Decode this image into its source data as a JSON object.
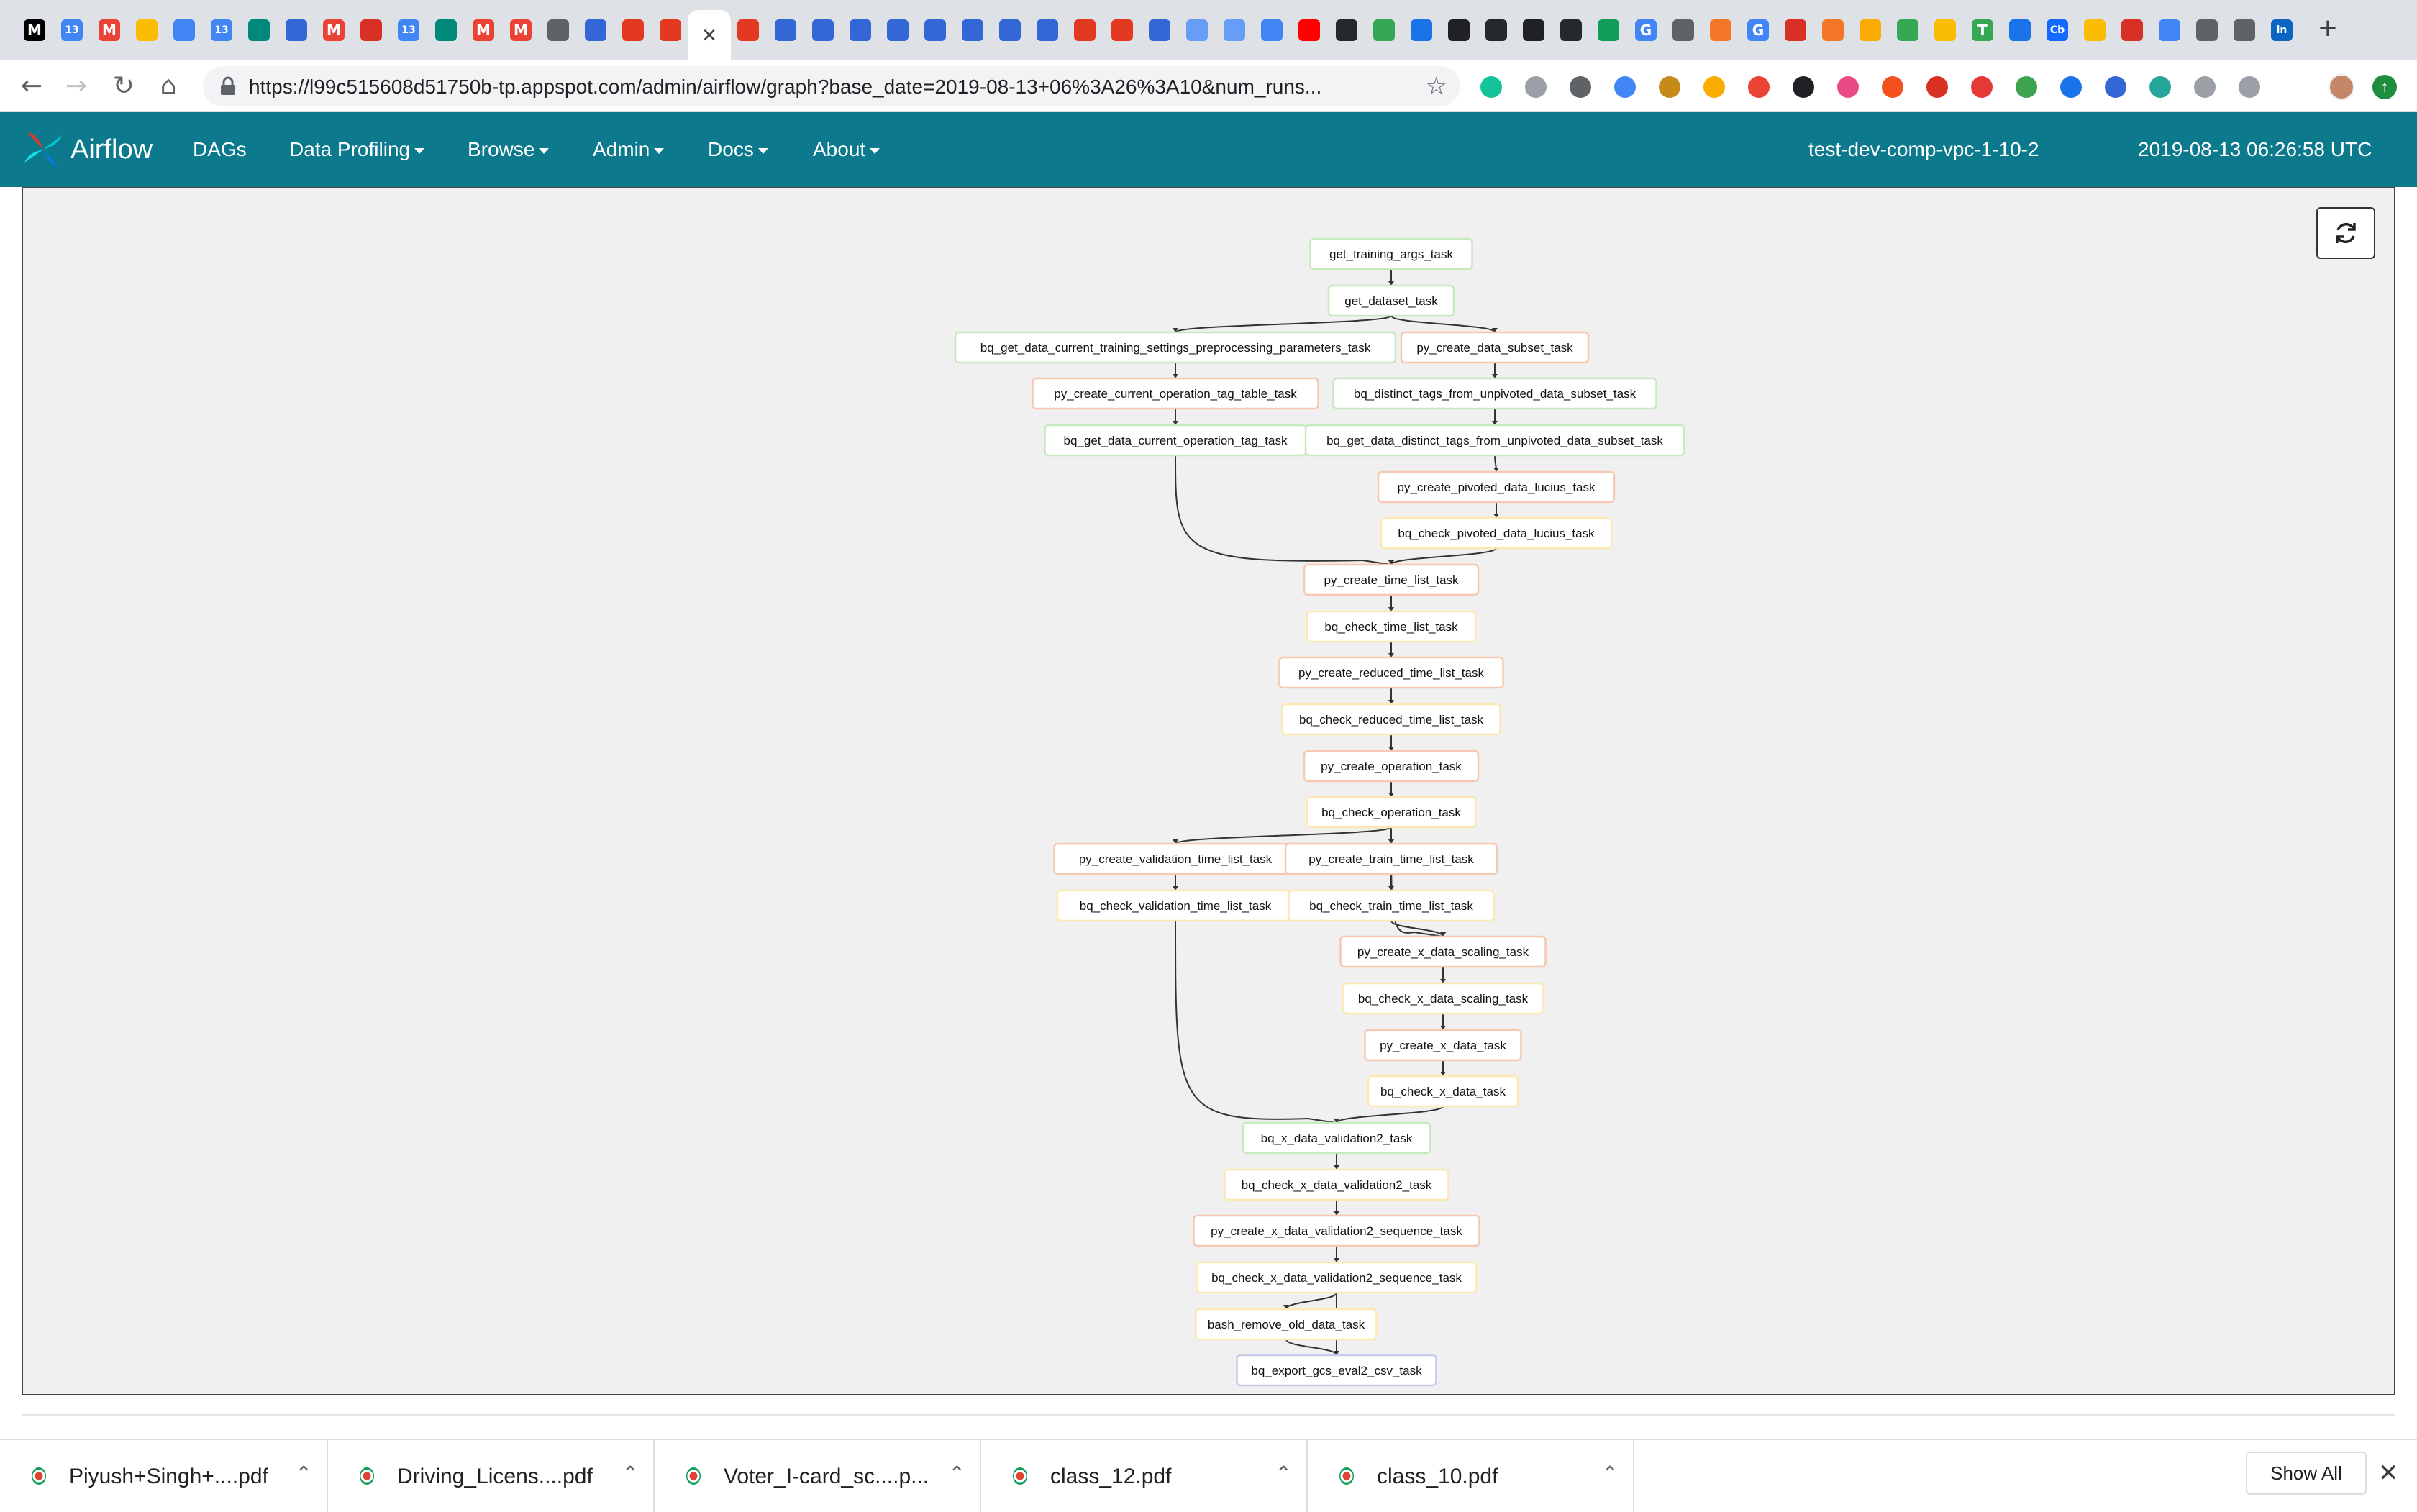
{
  "browser": {
    "tabs": [
      {
        "icon": "medium-icon",
        "glyph": "M",
        "color": "#000000"
      },
      {
        "icon": "calendar-icon",
        "glyph": "13",
        "color": "#4285f4"
      },
      {
        "icon": "gmail-icon",
        "glyph": "M",
        "color": "#ea4335"
      },
      {
        "icon": "slides-icon",
        "glyph": "",
        "color": "#fbbc04"
      },
      {
        "icon": "shield-icon",
        "glyph": "",
        "color": "#4285f4"
      },
      {
        "icon": "calendar-icon",
        "glyph": "13",
        "color": "#4285f4"
      },
      {
        "icon": "meet-icon",
        "glyph": "",
        "color": "#00897b"
      },
      {
        "icon": "list-icon",
        "glyph": "",
        "color": "#3367d6"
      },
      {
        "icon": "gmail-icon",
        "glyph": "M",
        "color": "#ea4335"
      },
      {
        "icon": "record-icon",
        "glyph": "",
        "color": "#d93025"
      },
      {
        "icon": "calendar-icon",
        "glyph": "13",
        "color": "#4285f4"
      },
      {
        "icon": "meet-icon",
        "glyph": "",
        "color": "#00897b"
      },
      {
        "icon": "gmail-icon",
        "glyph": "M",
        "color": "#ea4335"
      },
      {
        "icon": "gmail-icon",
        "glyph": "M",
        "color": "#ea4335"
      },
      {
        "icon": "gear-icon",
        "glyph": "",
        "color": "#5f6368"
      },
      {
        "icon": "storage-icon",
        "glyph": "",
        "color": "#3367d6"
      },
      {
        "icon": "airflow-icon",
        "glyph": "",
        "color": "#e43921"
      },
      {
        "icon": "airflow-icon",
        "glyph": "",
        "color": "#e43921"
      },
      {
        "icon": "airflow-icon",
        "glyph": "",
        "color": "#e43921"
      },
      {
        "icon": "cloud-icon",
        "glyph": "",
        "color": "#3367d6"
      },
      {
        "icon": "cloud-icon",
        "glyph": "",
        "color": "#3367d6"
      },
      {
        "icon": "list-icon",
        "glyph": "",
        "color": "#3367d6"
      },
      {
        "icon": "list-icon",
        "glyph": "",
        "color": "#3367d6"
      },
      {
        "icon": "cloud-icon",
        "glyph": "",
        "color": "#3367d6"
      },
      {
        "icon": "list-icon",
        "glyph": "",
        "color": "#3367d6"
      },
      {
        "icon": "list-icon",
        "glyph": "",
        "color": "#3367d6"
      },
      {
        "icon": "storage-icon",
        "glyph": "",
        "color": "#3367d6"
      },
      {
        "icon": "airflow-icon",
        "glyph": "",
        "color": "#e43921"
      },
      {
        "icon": "airflow-icon",
        "glyph": "",
        "color": "#e43921"
      },
      {
        "icon": "search-icon",
        "glyph": "",
        "color": "#3367d6"
      },
      {
        "icon": "hexagon-icon",
        "glyph": "",
        "color": "#669df6"
      },
      {
        "icon": "hexagon-icon",
        "glyph": "",
        "color": "#669df6"
      },
      {
        "icon": "onedrive-icon",
        "glyph": "",
        "color": "#4285f4"
      },
      {
        "icon": "youtube-icon",
        "glyph": "",
        "color": "#ff0000"
      },
      {
        "icon": "github-icon",
        "glyph": "",
        "color": "#24292e"
      },
      {
        "icon": "smile-icon",
        "glyph": "",
        "color": "#34a853"
      },
      {
        "icon": "vscode-icon",
        "glyph": "",
        "color": "#1a73e8"
      },
      {
        "icon": "music-icon",
        "glyph": "",
        "color": "#202124"
      },
      {
        "icon": "github-icon",
        "glyph": "",
        "color": "#24292e"
      },
      {
        "icon": "music-icon",
        "glyph": "",
        "color": "#202124"
      },
      {
        "icon": "github-icon",
        "glyph": "",
        "color": "#24292e"
      },
      {
        "icon": "excel-icon",
        "glyph": "",
        "color": "#0f9d58"
      },
      {
        "icon": "google-icon",
        "glyph": "G",
        "color": "#4285f4"
      },
      {
        "icon": "chrome-icon",
        "glyph": "",
        "color": "#5f6368"
      },
      {
        "icon": "jupyter-icon",
        "glyph": "",
        "color": "#f37726"
      },
      {
        "icon": "google-icon",
        "glyph": "G",
        "color": "#4285f4"
      },
      {
        "icon": "code-icon",
        "glyph": "",
        "color": "#d93025"
      },
      {
        "icon": "jupyter-icon",
        "glyph": "",
        "color": "#f37726"
      },
      {
        "icon": "notebook-icon",
        "glyph": "",
        "color": "#f9ab00"
      },
      {
        "icon": "w3-icon",
        "glyph": "",
        "color": "#34a853"
      },
      {
        "icon": "gear-icon",
        "glyph": "",
        "color": "#fbbc04"
      },
      {
        "icon": "text-icon",
        "glyph": "T",
        "color": "#34a853"
      },
      {
        "icon": "vscode-icon",
        "glyph": "",
        "color": "#1a73e8"
      },
      {
        "icon": "crunchbase-icon",
        "glyph": "Cb",
        "color": "#146aff"
      },
      {
        "icon": "drive-icon",
        "glyph": "",
        "color": "#fbbc04"
      },
      {
        "icon": "bug-icon",
        "glyph": "",
        "color": "#d93025"
      },
      {
        "icon": "flow-icon",
        "glyph": "",
        "color": "#4285f4"
      },
      {
        "icon": "chrome-icon",
        "glyph": "",
        "color": "#5f6368"
      },
      {
        "icon": "chrome-icon",
        "glyph": "",
        "color": "#5f6368"
      },
      {
        "icon": "linkedin-icon",
        "glyph": "in",
        "color": "#0a66c2"
      }
    ],
    "active_tab_icon": "close-icon",
    "url": "https://l99c515608d51750b-tp.appspot.com/admin/airflow/graph?base_date=2019-08-13+06%3A26%3A10&num_runs...",
    "extensions": [
      {
        "icon": "grammarly-icon",
        "color": "#15c39a"
      },
      {
        "icon": "extension-icon",
        "color": "#9aa0a6"
      },
      {
        "icon": "laptop-icon",
        "color": "#5f6368"
      },
      {
        "icon": "window-icon",
        "color": "#4285f4"
      },
      {
        "icon": "film-icon",
        "color": "#c58a1a"
      },
      {
        "icon": "note-icon",
        "color": "#f9ab00"
      },
      {
        "icon": "pie-icon",
        "color": "#ea4335"
      },
      {
        "icon": "braces-icon",
        "color": "#202124"
      },
      {
        "icon": "cat-icon",
        "color": "#e94b87"
      },
      {
        "icon": "fire-icon",
        "color": "#f4511e"
      },
      {
        "icon": "forward-icon",
        "color": "#d93025"
      },
      {
        "icon": "adblock-icon",
        "color": "#e53935"
      },
      {
        "icon": "cors-icon",
        "color": "#3ea34f"
      },
      {
        "icon": "shield-icon",
        "color": "#1a73e8"
      },
      {
        "icon": "lastpass-icon",
        "color": "#3367d6"
      },
      {
        "icon": "circle-icon",
        "color": "#26a69a"
      },
      {
        "icon": "puzzle-icon",
        "color": "#9aa0a6"
      },
      {
        "icon": "doc-icon",
        "color": "#9aa0a6"
      }
    ]
  },
  "navbar": {
    "brand": "Airflow",
    "items": [
      {
        "label": "DAGs",
        "dropdown": false
      },
      {
        "label": "Data Profiling",
        "dropdown": true
      },
      {
        "label": "Browse",
        "dropdown": true
      },
      {
        "label": "Admin",
        "dropdown": true
      },
      {
        "label": "Docs",
        "dropdown": true
      },
      {
        "label": "About",
        "dropdown": true
      }
    ],
    "hostname": "test-dev-comp-vpc-1-10-2",
    "time": "2019-08-13 06:26:58 UTC",
    "color": "#0c7a8c"
  },
  "graph": {
    "status_colors": {
      "green": "#c7e9c0",
      "peach": "#f7c8b0",
      "yellow": "#fce8b0",
      "blue": "#c5cbe9"
    },
    "tasks": [
      {
        "id": "t1",
        "label": "get_training_args_task",
        "status": "green"
      },
      {
        "id": "t2",
        "label": "get_dataset_task",
        "status": "green"
      },
      {
        "id": "t3",
        "label": "bq_get_data_current_training_settings_preprocessing_parameters_task",
        "status": "green"
      },
      {
        "id": "t4",
        "label": "py_create_data_subset_task",
        "status": "peach"
      },
      {
        "id": "t5",
        "label": "py_create_current_operation_tag_table_task",
        "status": "peach"
      },
      {
        "id": "t6",
        "label": "bq_distinct_tags_from_unpivoted_data_subset_task",
        "status": "green"
      },
      {
        "id": "t7",
        "label": "bq_get_data_current_operation_tag_task",
        "status": "green"
      },
      {
        "id": "t8",
        "label": "bq_get_data_distinct_tags_from_unpivoted_data_subset_task",
        "status": "green"
      },
      {
        "id": "t9",
        "label": "py_create_pivoted_data_lucius_task",
        "status": "peach"
      },
      {
        "id": "t10",
        "label": "bq_check_pivoted_data_lucius_task",
        "status": "yellow"
      },
      {
        "id": "t11",
        "label": "py_create_time_list_task",
        "status": "peach"
      },
      {
        "id": "t12",
        "label": "bq_check_time_list_task",
        "status": "yellow"
      },
      {
        "id": "t13",
        "label": "py_create_reduced_time_list_task",
        "status": "peach"
      },
      {
        "id": "t14",
        "label": "bq_check_reduced_time_list_task",
        "status": "yellow"
      },
      {
        "id": "t15",
        "label": "py_create_operation_task",
        "status": "peach"
      },
      {
        "id": "t16",
        "label": "bq_check_operation_task",
        "status": "yellow"
      },
      {
        "id": "t17",
        "label": "py_create_validation_time_list_task",
        "status": "peach"
      },
      {
        "id": "t18",
        "label": "py_create_train_time_list_task",
        "status": "peach"
      },
      {
        "id": "t19",
        "label": "bq_check_validation_time_list_task",
        "status": "yellow"
      },
      {
        "id": "t20",
        "label": "bq_check_train_time_list_task",
        "status": "yellow"
      },
      {
        "id": "t21",
        "label": "py_create_x_data_scaling_task",
        "status": "peach"
      },
      {
        "id": "t22",
        "label": "bq_check_x_data_scaling_task",
        "status": "yellow"
      },
      {
        "id": "t23",
        "label": "py_create_x_data_task",
        "status": "peach"
      },
      {
        "id": "t24",
        "label": "bq_check_x_data_task",
        "status": "yellow"
      },
      {
        "id": "t25",
        "label": "bq_x_data_validation2_task",
        "status": "green"
      },
      {
        "id": "t26",
        "label": "bq_check_x_data_validation2_task",
        "status": "yellow"
      },
      {
        "id": "t27",
        "label": "py_create_x_data_validation2_sequence_task",
        "status": "peach"
      },
      {
        "id": "t28",
        "label": "bq_check_x_data_validation2_sequence_task",
        "status": "yellow"
      },
      {
        "id": "t29",
        "label": "bash_remove_old_data_task",
        "status": "yellow"
      },
      {
        "id": "t30",
        "label": "bq_export_gcs_eval2_csv_task",
        "status": "blue"
      }
    ],
    "edges": [
      [
        "t1",
        "t2"
      ],
      [
        "t2",
        "t3"
      ],
      [
        "t2",
        "t4"
      ],
      [
        "t3",
        "t5"
      ],
      [
        "t4",
        "t6"
      ],
      [
        "t5",
        "t7"
      ],
      [
        "t6",
        "t8"
      ],
      [
        "t8",
        "t9"
      ],
      [
        "t9",
        "t10"
      ],
      [
        "t7",
        "t11"
      ],
      [
        "t10",
        "t11"
      ],
      [
        "t11",
        "t12"
      ],
      [
        "t12",
        "t13"
      ],
      [
        "t13",
        "t14"
      ],
      [
        "t14",
        "t15"
      ],
      [
        "t15",
        "t16"
      ],
      [
        "t16",
        "t17"
      ],
      [
        "t16",
        "t18"
      ],
      [
        "t17",
        "t19"
      ],
      [
        "t18",
        "t20"
      ],
      [
        "t16",
        "t21"
      ],
      [
        "t20",
        "t21"
      ],
      [
        "t21",
        "t22"
      ],
      [
        "t22",
        "t23"
      ],
      [
        "t23",
        "t24"
      ],
      [
        "t19",
        "t25"
      ],
      [
        "t24",
        "t25"
      ],
      [
        "t25",
        "t26"
      ],
      [
        "t26",
        "t27"
      ],
      [
        "t27",
        "t28"
      ],
      [
        "t28",
        "t29"
      ],
      [
        "t28",
        "t30"
      ],
      [
        "t29",
        "t30"
      ]
    ]
  },
  "downloads": {
    "items": [
      {
        "name": "Piyush+Singh+....pdf"
      },
      {
        "name": "Driving_Licens....pdf"
      },
      {
        "name": "Voter_I-card_sc....p..."
      },
      {
        "name": "class_12.pdf"
      },
      {
        "name": "class_10.pdf"
      }
    ],
    "show_all": "Show All"
  }
}
